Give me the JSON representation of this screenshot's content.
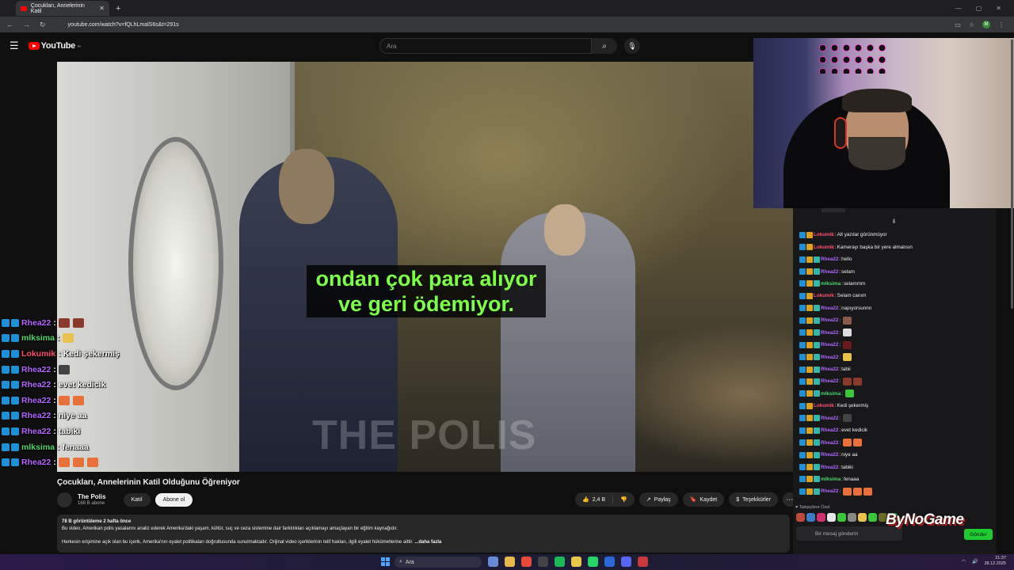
{
  "browser": {
    "tab_title": "Çocukları, Annelerinin Katil",
    "url": "youtube.com/watch?v=fQLhLmalS6s&t=291s",
    "profile_initial": "M"
  },
  "youtube": {
    "logo_text": "YouTube",
    "logo_sup": "TR",
    "search_placeholder": "Ara"
  },
  "video": {
    "subtitle_line1": "ondan çok para alıyor",
    "subtitle_line2": "ve geri ödemiyor.",
    "watermark": "THE POLIS",
    "title": "Çocukları, Annelerinin Katil Olduğunu Öğreniyor",
    "channel_name": "The Polis",
    "channel_subs": "168 B abone",
    "join_label": "Katıl",
    "subscribe_label": "Abone ol",
    "like_count": "2,4 B",
    "share_label": "Paylaş",
    "save_label": "Kaydet",
    "thanks_label": "Teşekkürler",
    "description_stats": "78 B görüntüleme  2 hafta önce",
    "description_line1": "Bu video, Amerikan polis yasalarını analiz ederek Amerika'daki yaşam, kültür, suç ve ceza sistemine dair farklılıkları açıklamayı amaçlayan bir eğitim kaynağıdır.",
    "description_line2": "Herkesin erişimine açık olan bu içerik, Amerika'nın eyalet politikaları doğrultusunda sunulmaktadır. Orijinal video içeriklerinin telif hakları, ilgili eyalet hükümetlerine aittir.",
    "description_more": "...daha fazla"
  },
  "overlay_chat": [
    {
      "user": "Rhea22",
      "color": "#b366ff",
      "msg": "",
      "emotes": [
        "#8a3a2a",
        "#8a3a2a"
      ]
    },
    {
      "user": "mlksima",
      "color": "#4bd66b",
      "msg": "",
      "emotes": [
        "#e8c24a"
      ]
    },
    {
      "user": "Lokumik",
      "color": "#ff4f6a",
      "msg": "Kedi şekermiş",
      "emotes": []
    },
    {
      "user": "Rhea22",
      "color": "#b366ff",
      "msg": "",
      "emotes": [
        "#444"
      ]
    },
    {
      "user": "Rhea22",
      "color": "#b366ff",
      "msg": "evet kedicik",
      "emotes": []
    },
    {
      "user": "Rhea22",
      "color": "#b366ff",
      "msg": "",
      "emotes": [
        "#e8703a",
        "#e8703a"
      ]
    },
    {
      "user": "Rhea22",
      "color": "#b366ff",
      "msg": "niye aa",
      "emotes": []
    },
    {
      "user": "Rhea22",
      "color": "#b366ff",
      "msg": "tabiki",
      "emotes": []
    },
    {
      "user": "mlksima",
      "color": "#4bd66b",
      "msg": "fenaaa",
      "emotes": []
    },
    {
      "user": "Rhea22",
      "color": "#b366ff",
      "msg": "",
      "emotes": [
        "#e8703a",
        "#e8703a",
        "#e8703a"
      ]
    }
  ],
  "chat": {
    "messages": [
      {
        "user": "Lokumik",
        "color": "#ff4f6a",
        "msg": "Alt yazılar görünmüyor",
        "badges": 1
      },
      {
        "user": "Lokumik",
        "color": "#ff4f6a",
        "msg": "Kamerayı başka bir yere almalısın",
        "badges": 1
      },
      {
        "user": "Rhea22",
        "color": "#b366ff",
        "msg": "hello",
        "badges": 3
      },
      {
        "user": "Rhea22",
        "color": "#b366ff",
        "msg": "selam",
        "badges": 3
      },
      {
        "user": "mlksima",
        "color": "#4bd66b",
        "msg": "selammm",
        "badges": 3
      },
      {
        "user": "Lokumik",
        "color": "#ff4f6a",
        "msg": "Selam canım",
        "badges": 1
      },
      {
        "user": "Rhea22",
        "color": "#b366ff",
        "msg": "napıyorsunnn",
        "badges": 3
      },
      {
        "user": "Rhea22",
        "color": "#b366ff",
        "msg": "",
        "badges": 3,
        "emotes": [
          "#8a5a4a"
        ]
      },
      {
        "user": "Rhea22",
        "color": "#b366ff",
        "msg": "",
        "badges": 3,
        "emotes": [
          "#dddddd"
        ]
      },
      {
        "user": "Rhea22",
        "color": "#b366ff",
        "msg": "",
        "badges": 3,
        "emotes": [
          "#6a1a1a"
        ]
      },
      {
        "user": "Rhea22",
        "color": "#b366ff",
        "msg": "",
        "badges": 3,
        "emotes": [
          "#e8c24a"
        ]
      },
      {
        "user": "Rhea22",
        "color": "#b366ff",
        "msg": "tabii",
        "badges": 3
      },
      {
        "user": "Rhea22",
        "color": "#b366ff",
        "msg": "",
        "badges": 3,
        "emotes": [
          "#8a3a2a",
          "#8a3a2a"
        ]
      },
      {
        "user": "mlksima",
        "color": "#4bd66b",
        "msg": "",
        "badges": 3,
        "emotes": [
          "#3ac83a"
        ]
      },
      {
        "user": "Lokumik",
        "color": "#ff4f6a",
        "msg": "Kedi şekermiş",
        "badges": 1
      },
      {
        "user": "Rhea22",
        "color": "#b366ff",
        "msg": "",
        "badges": 3,
        "emotes": [
          "#444"
        ]
      },
      {
        "user": "Rhea22",
        "color": "#b366ff",
        "msg": "evet kedicik",
        "badges": 3
      },
      {
        "user": "Rhea22",
        "color": "#b366ff",
        "msg": "",
        "badges": 3,
        "emotes": [
          "#e8703a",
          "#e8703a"
        ]
      },
      {
        "user": "Rhea22",
        "color": "#b366ff",
        "msg": "niye aa",
        "badges": 3
      },
      {
        "user": "Rhea22",
        "color": "#b366ff",
        "msg": "tabiki",
        "badges": 3
      },
      {
        "user": "mlksima",
        "color": "#4bd66b",
        "msg": "fenaaa",
        "badges": 3
      },
      {
        "user": "Rhea22",
        "color": "#b366ff",
        "msg": "",
        "badges": 3,
        "emotes": [
          "#e8703a",
          "#e8703a",
          "#e8703a"
        ]
      }
    ],
    "followers_label": "Takipçilere Özel",
    "input_placeholder": "Bir mesaj gönderin",
    "send_label": "Gönder"
  },
  "overlay_brand": "ByNoGame",
  "taskbar": {
    "search_label": "Ara",
    "time": "21:37",
    "date": "28.12.2025"
  },
  "colors": {
    "subtitle": "#7dff48",
    "youtube_red": "#ff0000",
    "send_green": "#1ecb31"
  }
}
